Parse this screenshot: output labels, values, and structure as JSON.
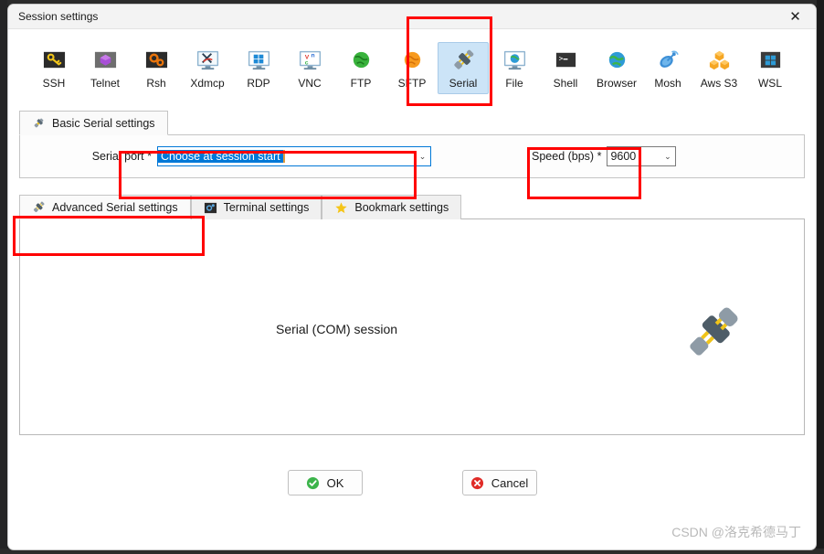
{
  "window": {
    "title": "Session settings",
    "close_label": "✕"
  },
  "toolbar": {
    "protocols": [
      {
        "label": "SSH",
        "icon": "key-icon"
      },
      {
        "label": "Telnet",
        "icon": "cube-icon"
      },
      {
        "label": "Rsh",
        "icon": "gears-icon"
      },
      {
        "label": "Xdmcp",
        "icon": "xdmcp-monitor-icon"
      },
      {
        "label": "RDP",
        "icon": "rdp-monitor-icon"
      },
      {
        "label": "VNC",
        "icon": "vnc-monitor-icon"
      },
      {
        "label": "FTP",
        "icon": "green-globe-icon"
      },
      {
        "label": "SFTP",
        "icon": "orange-globe-icon"
      },
      {
        "label": "Serial",
        "icon": "plug-connector-icon",
        "selected": true
      },
      {
        "label": "File",
        "icon": "file-monitor-icon"
      },
      {
        "label": "Shell",
        "icon": "terminal-icon"
      },
      {
        "label": "Browser",
        "icon": "blue-globe-icon"
      },
      {
        "label": "Mosh",
        "icon": "satellite-dish-icon"
      },
      {
        "label": "Aws S3",
        "icon": "aws-buckets-icon"
      },
      {
        "label": "WSL",
        "icon": "windows-icon"
      }
    ]
  },
  "basic_tab": {
    "label": "Basic Serial settings",
    "icon": "plug-connector-icon"
  },
  "form": {
    "serial_port": {
      "label": "Serial port *",
      "value": "Choose at session start",
      "arrow": "⌄"
    },
    "speed": {
      "label": "Speed (bps) *",
      "value": "9600",
      "arrow": "⌄"
    }
  },
  "settings_tabs": [
    {
      "label": "Advanced Serial settings",
      "icon": "plug-connector-icon",
      "active": true
    },
    {
      "label": "Terminal settings",
      "icon": "terminal-settings-icon",
      "active": false
    },
    {
      "label": "Bookmark settings",
      "icon": "star-icon",
      "active": false
    }
  ],
  "content": {
    "heading": "Serial (COM) session",
    "graphic": "plug-connector-large-icon"
  },
  "footer": {
    "ok_label": "OK",
    "ok_icon": "green-check-icon",
    "cancel_label": "Cancel",
    "cancel_icon": "red-x-icon"
  },
  "watermark": {
    "text": "CSDN @洛克希德马丁"
  },
  "colors": {
    "accent_blue": "#0078d7",
    "annotation_red": "#ff0000",
    "selected_tab_bg": "#cce4f7"
  }
}
